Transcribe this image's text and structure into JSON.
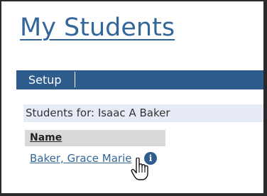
{
  "page": {
    "title": "My Students"
  },
  "menu": {
    "items": [
      {
        "label": "Setup"
      }
    ]
  },
  "students_for": {
    "label": "Students for: Isaac A Baker"
  },
  "table": {
    "columns": [
      "Name"
    ],
    "rows": [
      {
        "name": "Baker, Grace Marie",
        "info_icon": "info-icon"
      }
    ]
  },
  "cursor": {
    "icon": "hand-pointer-cursor-icon"
  },
  "colors": {
    "link": "#336699",
    "menu_bar": "#2e5c8c",
    "students_for_bg": "#e6ebf7",
    "header_bg": "#d9d9d9"
  }
}
